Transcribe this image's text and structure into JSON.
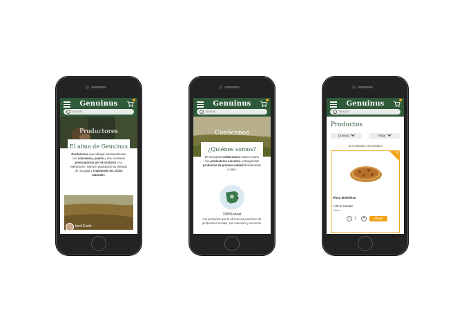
{
  "header": {
    "logo": "Genuinus",
    "search_placeholder": "Buscar"
  },
  "productores_screen": {
    "hero_title": "Productores",
    "card_title": "El alma de Genuinus",
    "card_text_segments": [
      {
        "t": "Productores",
        "b": true
      },
      {
        "t": " que trabajan artesanalmente con ",
        "b": false
      },
      {
        "t": "conciencia, pasión",
        "b": true
      },
      {
        "t": " y una constante ",
        "b": false
      },
      {
        "t": "preocupación por el producto",
        "b": true
      },
      {
        "t": " y su elaboración, siempre guardando los tiempos de recogida y ",
        "b": false
      },
      {
        "t": "respetando los ciclos naturales",
        "b": true
      },
      {
        "t": ".",
        "b": false
      }
    ],
    "producer_name": "Jordi Évole"
  },
  "conocenos_screen": {
    "hero_title": "Conócenos",
    "card_title": "¿Quiénes somos?",
    "card_text_segments": [
      {
        "t": "En Genuinus ",
        "b": false
      },
      {
        "t": "colaboramos",
        "b": true
      },
      {
        "t": " mano a mano con ",
        "b": false
      },
      {
        "t": "productores cercanos",
        "b": true
      },
      {
        "t": ", entregándote ",
        "b": false
      },
      {
        "t": "productos de primera calidad",
        "b": true
      },
      {
        "t": " directamente a casa.",
        "b": false
      }
    ],
    "local_title": "100% local",
    "local_text": "Los productos que te ofrecemos provienen de productores locales, son naturales y cercanos."
  },
  "productos_screen": {
    "page_title": "Productos",
    "sort_label": "Ordenar",
    "filter_label": "Filtrar",
    "results_text": "32 resultados encontrados",
    "corner_symbol": "€",
    "product": {
      "name": "Pizza Boloñesa",
      "price": "7,80 €/ Unidad",
      "location": "Girona",
      "quantity": "1",
      "add_label": "Añadir"
    }
  },
  "colors": {
    "brand_green": "#2f5a3a",
    "accent_orange": "#f2a417"
  }
}
